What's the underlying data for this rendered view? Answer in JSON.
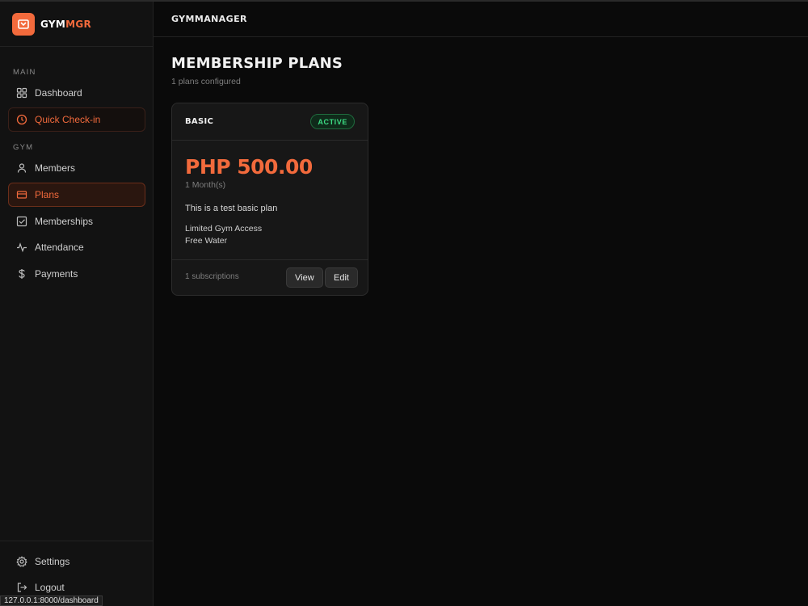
{
  "brand": {
    "part1": "GYM",
    "part2": "MGR",
    "accent": "#f26a3c"
  },
  "sidebar": {
    "sections": {
      "main": "MAIN",
      "gym": "GYM"
    },
    "items": {
      "dashboard": {
        "label": "Dashboard",
        "icon": "grid-icon"
      },
      "checkin": {
        "label": "Quick Check-in",
        "icon": "clock-icon"
      },
      "members": {
        "label": "Members",
        "icon": "user-icon"
      },
      "plans": {
        "label": "Plans",
        "icon": "credit-card-icon",
        "active": true
      },
      "memberships": {
        "label": "Memberships",
        "icon": "check-square-icon"
      },
      "attendance": {
        "label": "Attendance",
        "icon": "activity-icon"
      },
      "payments": {
        "label": "Payments",
        "icon": "dollar-icon"
      },
      "settings": {
        "label": "Settings",
        "icon": "gear-icon"
      },
      "logout": {
        "label": "Logout",
        "icon": "logout-icon"
      }
    }
  },
  "status_url": "127.0.0.1:8000/dashboard",
  "header": {
    "title": "GYMMANAGER"
  },
  "page": {
    "title": "MEMBERSHIP PLANS",
    "subtitle": "1 plans configured"
  },
  "plans": [
    {
      "name": "BASIC",
      "status": "ACTIVE",
      "price": "PHP 500.00",
      "duration": "1 Month(s)",
      "description": "This is a test basic plan",
      "features": [
        "Limited Gym Access",
        "Free Water"
      ],
      "subscriptions": "1 subscriptions",
      "view_label": "View",
      "edit_label": "Edit"
    }
  ]
}
